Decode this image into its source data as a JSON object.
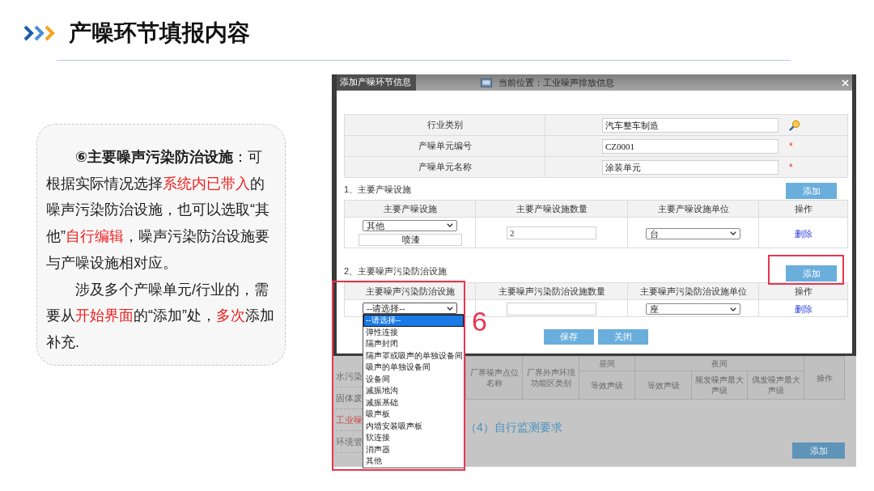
{
  "header": {
    "title": "产噪环节填报内容"
  },
  "note": {
    "paragraphs": [
      {
        "segments": [
          {
            "text": "⑥主要噪声污染防治设施",
            "kind": "bold"
          },
          {
            "text": "：可根据实际情况选择",
            "kind": "plain"
          },
          {
            "text": "系统内已带入",
            "kind": "highlight"
          },
          {
            "text": "的噪声污染防治设施，也可以选取“其他”",
            "kind": "plain"
          },
          {
            "text": "自行编辑",
            "kind": "highlight"
          },
          {
            "text": "，噪声污染防治设施要与产噪设施相对应。",
            "kind": "plain"
          }
        ]
      },
      {
        "segments": [
          {
            "text": "涉及多个产噪单元/行业的，需要从",
            "kind": "plain"
          },
          {
            "text": "开始界面",
            "kind": "highlight"
          },
          {
            "text": "的“添加”处，",
            "kind": "plain"
          },
          {
            "text": "多次",
            "kind": "highlight"
          },
          {
            "text": "添加补充.",
            "kind": "plain"
          }
        ]
      }
    ]
  },
  "screenshot": {
    "dialog": {
      "title": "添加产噪环节信息",
      "breadcrumb": "当前位置：工业噪声排放信息",
      "fields": [
        {
          "label": "行业类别",
          "value": "汽车整车制造",
          "kind": "lookup"
        },
        {
          "label": "产噪单元编号",
          "value": "CZ0001",
          "kind": "required",
          "required_mark": "*"
        },
        {
          "label": "产噪单元名称",
          "value": "涂装单元",
          "kind": "required",
          "required_mark": "*"
        }
      ],
      "sections": [
        {
          "title": "1、主要产噪设施",
          "add_button": "添加",
          "highlighted": false,
          "columns": [
            "主要产噪设施",
            "主要产噪设施数量",
            "主要产噪设施单位",
            "操作"
          ],
          "rows": [
            {
              "facility": {
                "value": "其他",
                "expanded": false,
                "custom": "喷漆"
              },
              "quantity": "2",
              "unit": "台",
              "action": "删除"
            }
          ]
        },
        {
          "title": "2、主要噪声污染防治设施",
          "add_button": "添加",
          "highlighted": true,
          "callout": {
            "label": "6"
          },
          "columns": [
            "主要噪声污染防治设施",
            "主要噪声污染防治设施数量",
            "主要噪声污染防治设施单位",
            "操作"
          ],
          "rows": [
            {
              "facility": {
                "value": "--请选择--",
                "expanded": true,
                "options": [
                  {
                    "label": "--请选择--",
                    "selected": true
                  },
                  {
                    "label": "弹性连接",
                    "selected": false
                  },
                  {
                    "label": "隔声封闭",
                    "selected": false
                  },
                  {
                    "label": "隔声罩或吸声的单独设备间",
                    "selected": false
                  },
                  {
                    "label": "吸声的单独设备间",
                    "selected": false
                  },
                  {
                    "label": "设备间",
                    "selected": false
                  },
                  {
                    "label": "减振地沟",
                    "selected": false
                  },
                  {
                    "label": "减振基础",
                    "selected": false
                  },
                  {
                    "label": "吸声板",
                    "selected": false
                  },
                  {
                    "label": "内墙安装吸声板",
                    "selected": false
                  },
                  {
                    "label": "软连接",
                    "selected": false
                  },
                  {
                    "label": "消声器",
                    "selected": false
                  },
                  {
                    "label": "其他",
                    "selected": false
                  }
                ]
              },
              "unit": "座",
              "action": "删除"
            }
          ]
        }
      ],
      "buttons": [
        "保存",
        "关闭"
      ]
    },
    "background": {
      "nav": [
        {
          "label": "水污染",
          "selected": false
        },
        {
          "label": "固体废",
          "selected": false
        },
        {
          "label": "工业噪",
          "selected": true
        },
        {
          "label": "环境管",
          "selected": false
        }
      ],
      "table": {
        "columns": [
          {
            "label": "厂界噪声点位名称"
          },
          {
            "label": "厂界外声环境功能区类别"
          },
          {
            "label": "昼间",
            "children": [
              {
                "label": "等效声级"
              }
            ]
          },
          {
            "label": "夜间",
            "children": [
              {
                "label": "等效声级"
              },
              {
                "label": "频发噪声最大声级"
              },
              {
                "label": "偶发噪声最大声级"
              }
            ]
          },
          {
            "label": "操作"
          }
        ]
      },
      "section_title": "（4）自行监测要求",
      "add_button": "添加"
    }
  }
}
